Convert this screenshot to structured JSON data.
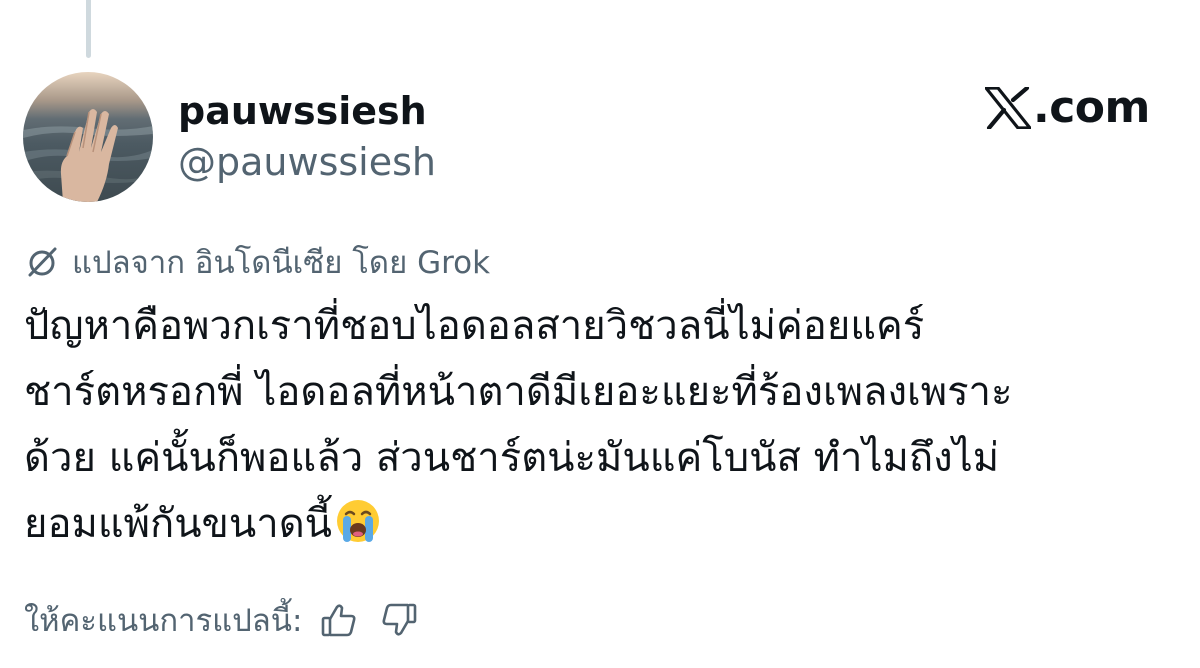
{
  "author": {
    "display_name": "pauwssiesh",
    "handle": "@pauwssiesh"
  },
  "brand": {
    "label": ".com",
    "icon": "x-logo-icon"
  },
  "translation": {
    "icon": "translate-slash-icon",
    "label": "แปลจาก อินโดนีเซีย โดย Grok"
  },
  "tweet": {
    "lines": [
      "ปัญหาคือพวกเราที่ชอบไอดอลสายวิชวลนี่ไม่ค่อยแคร์",
      "ชาร์ตหรอกพี่ ไอดอลที่หน้าตาดีมีเยอะแยะที่ร้องเพลงเพราะ",
      "ด้วย แค่นั้นก็พอแล้ว ส่วนชาร์ตน่ะมันแค่โบนัส ทำไมถึงไม่",
      "ยอมแพ้กันขนาดนี้"
    ],
    "emoji": "loudly-crying-face-emoji"
  },
  "rating": {
    "label": "ให้คะแนนการแปลนี้:",
    "up_icon": "thumbs-up-icon",
    "down_icon": "thumbs-down-icon"
  },
  "colors": {
    "text_primary": "#0f1419",
    "text_secondary": "#536471",
    "thread_line": "#cfd9de"
  }
}
